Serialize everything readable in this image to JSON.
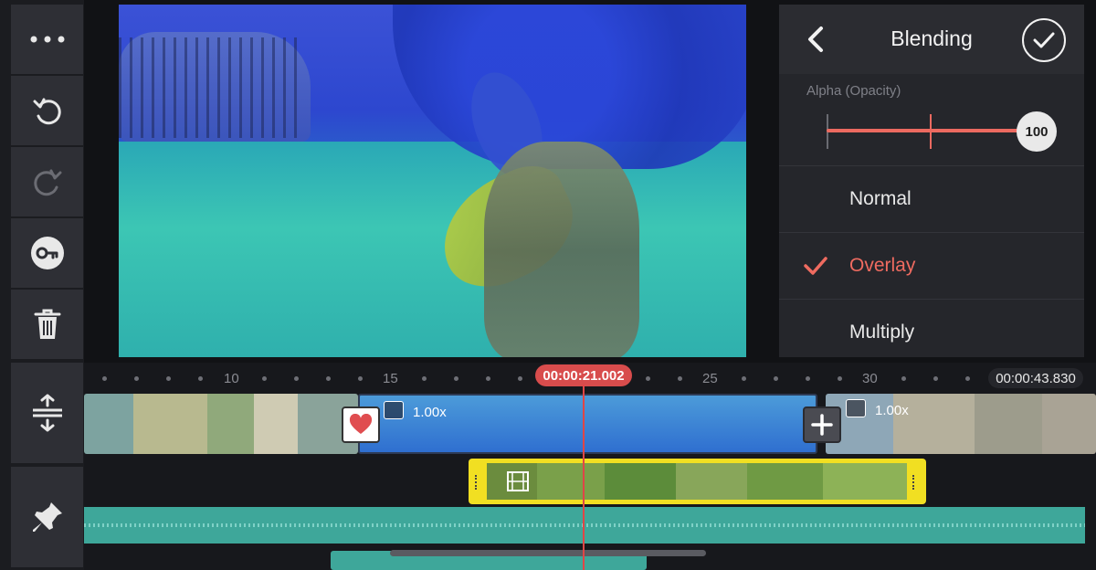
{
  "toolbar": {
    "items": [
      {
        "name": "more-menu",
        "icon": "more-icon"
      },
      {
        "name": "undo",
        "icon": "undo-icon"
      },
      {
        "name": "redo",
        "icon": "redo-icon"
      },
      {
        "name": "keyframe",
        "icon": "key-icon"
      },
      {
        "name": "delete",
        "icon": "trash-icon"
      }
    ],
    "timeline_tools": [
      {
        "name": "expand-tracks",
        "icon": "expand-vertical-icon"
      },
      {
        "name": "pin",
        "icon": "pin-icon"
      }
    ]
  },
  "blending_panel": {
    "title": "Blending",
    "alpha_label": "Alpha (Opacity)",
    "alpha_value": "100",
    "modes": [
      {
        "label": "Normal",
        "selected": false
      },
      {
        "label": "Overlay",
        "selected": true
      },
      {
        "label": "Multiply",
        "selected": false
      }
    ],
    "accent_color": "#ef6b60"
  },
  "timeline": {
    "ruler_labels": [
      "10",
      "15",
      "25",
      "30"
    ],
    "current_time": "00:00:21.002",
    "total_time": "00:00:43.830",
    "clips": [
      {
        "name": "clip-dogs"
      },
      {
        "name": "clip-turtle",
        "speed": "1.00x"
      },
      {
        "name": "clip-elephants",
        "speed": "1.00x"
      }
    ],
    "overlay_clip": {
      "name": "cat-layer",
      "color": "#f1df22"
    },
    "audio_color": "#3ea79a"
  }
}
